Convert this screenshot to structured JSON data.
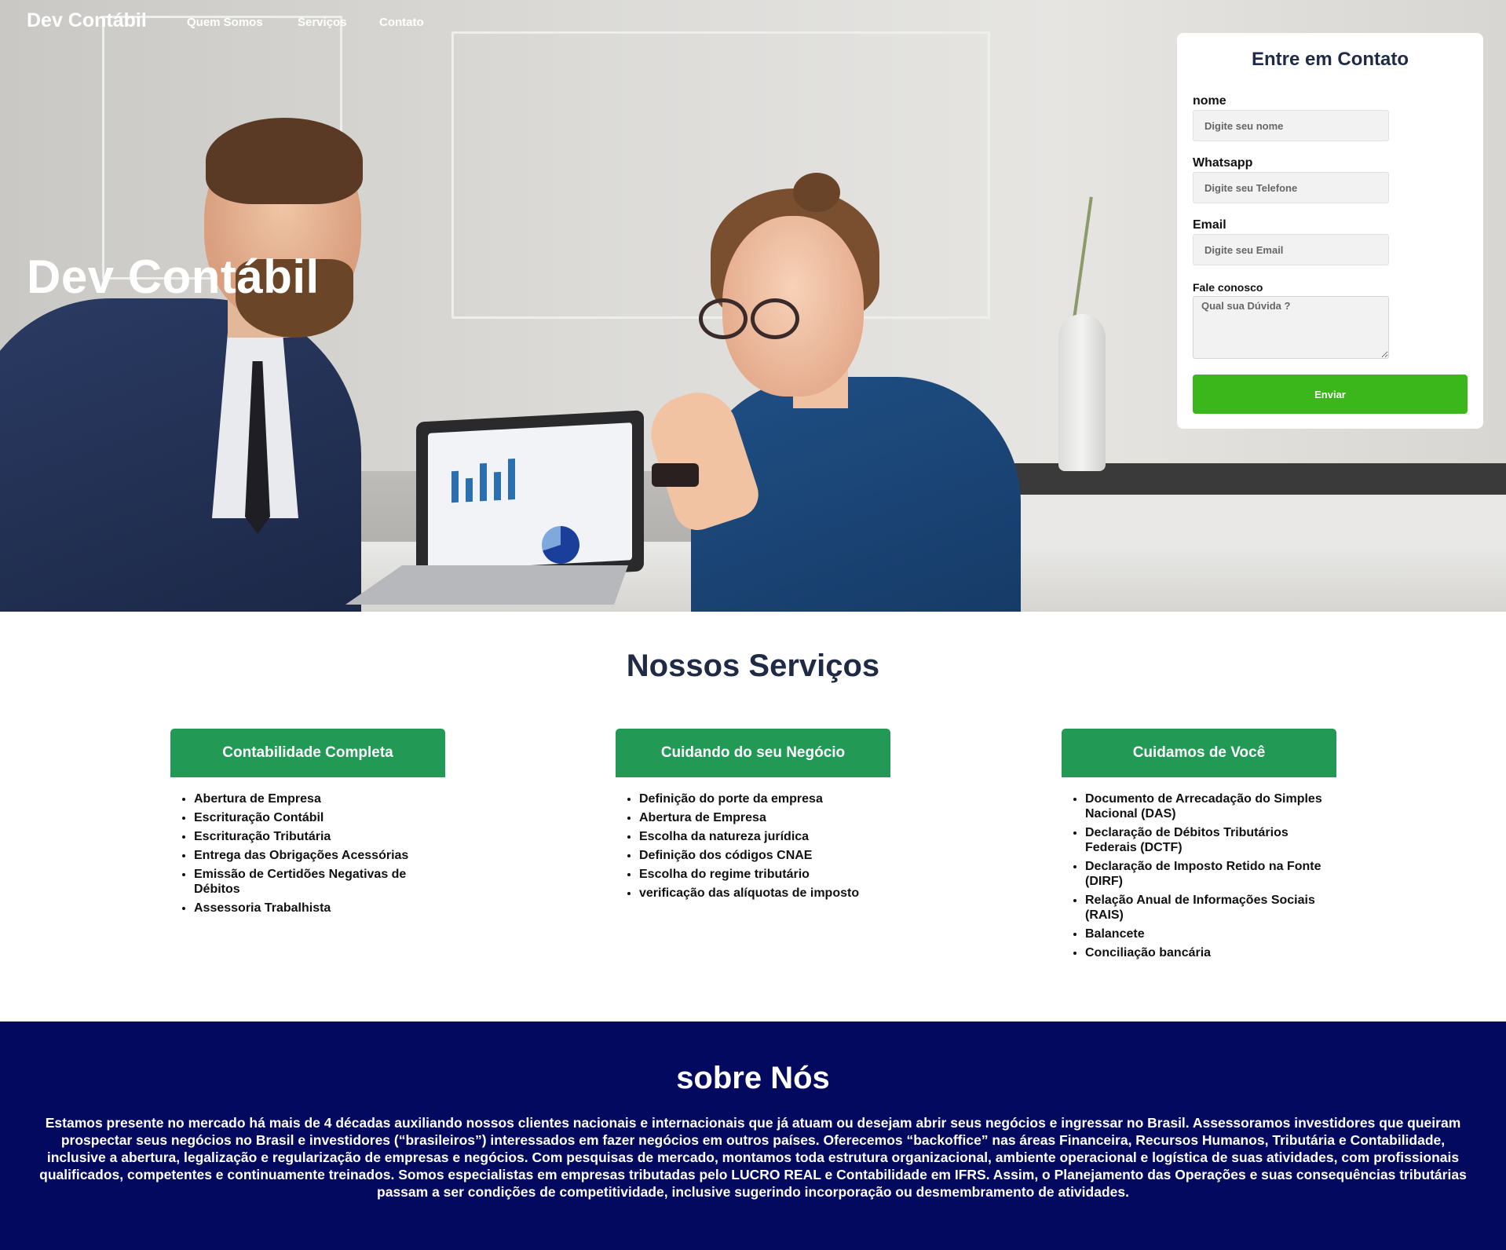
{
  "nav": {
    "brand": "Dev Contábil",
    "links": [
      "Quem Somos",
      "Serviços",
      "Contato"
    ]
  },
  "hero": {
    "title": "Dev Contábil"
  },
  "contact_form": {
    "title": "Entre em Contato",
    "name_label": "nome",
    "name_placeholder": "Digite seu nome",
    "whatsapp_label": "Whatsapp",
    "whatsapp_placeholder": "Digite seu Telefone",
    "email_label": "Email",
    "email_placeholder": "Digite seu Email",
    "message_label": "Fale conosco",
    "message_placeholder": "Qual sua Dúvida ?",
    "submit_label": "Enviar"
  },
  "services": {
    "title": "Nossos Serviços",
    "columns": [
      {
        "title": "Contabilidade Completa",
        "items": [
          "Abertura de Empresa",
          "Escrituração Contábil",
          "Escrituração Tributária",
          "Entrega das Obrigações Acessórias",
          "Emissão de Certidões Negativas de Débitos",
          "Assessoria Trabalhista"
        ]
      },
      {
        "title": "Cuidando do seu Negócio",
        "items": [
          "Definição do porte da empresa",
          "Abertura de Empresa",
          "Escolha da natureza jurídica",
          "Definição dos códigos CNAE",
          "Escolha do regime tributário",
          "verificação das alíquotas de imposto"
        ]
      },
      {
        "title": "Cuidamos de Você",
        "items": [
          "Documento de Arrecadação do Simples Nacional (DAS)",
          "Declaração de Débitos Tributários Federais (DCTF)",
          "Declaração de Imposto Retido na Fonte (DIRF)",
          "Relação Anual de Informações Sociais (RAIS)",
          "Balancete",
          "Conciliação bancária"
        ]
      }
    ]
  },
  "about": {
    "title": "sobre Nós",
    "text": "Estamos presente no mercado há mais de 4 décadas auxiliando nossos clientes nacionais e internacionais que já atuam ou desejam abrir seus negócios e ingressar no Brasil. Assessoramos investidores que queiram prospectar seus negócios no Brasil e investidores (“brasileiros”) interessados em fazer negócios em outros países. Oferecemos “backoffice” nas áreas Financeira, Recursos Humanos, Tributária e Contabilidade, inclusive a abertura, legalização e regularização de empresas e negócios. Com pesquisas de mercado, montamos toda estrutura organizacional, ambiente operacional e logística de suas atividades, com profissionais qualificados, competentes e continuamente treinados. Somos especialistas em empresas tributadas pelo LUCRO REAL e Contabilidade em IFRS. Assim, o Planejamento das Operações e suas consequências tributárias passam a ser condições de competitividade, inclusive sugerindo incorporação ou desmembramento de atividades."
  },
  "colors": {
    "service_header_green": "#229a55",
    "submit_green": "#3bb71b",
    "about_navy": "#03095f",
    "title_navy": "#1f2a44"
  }
}
